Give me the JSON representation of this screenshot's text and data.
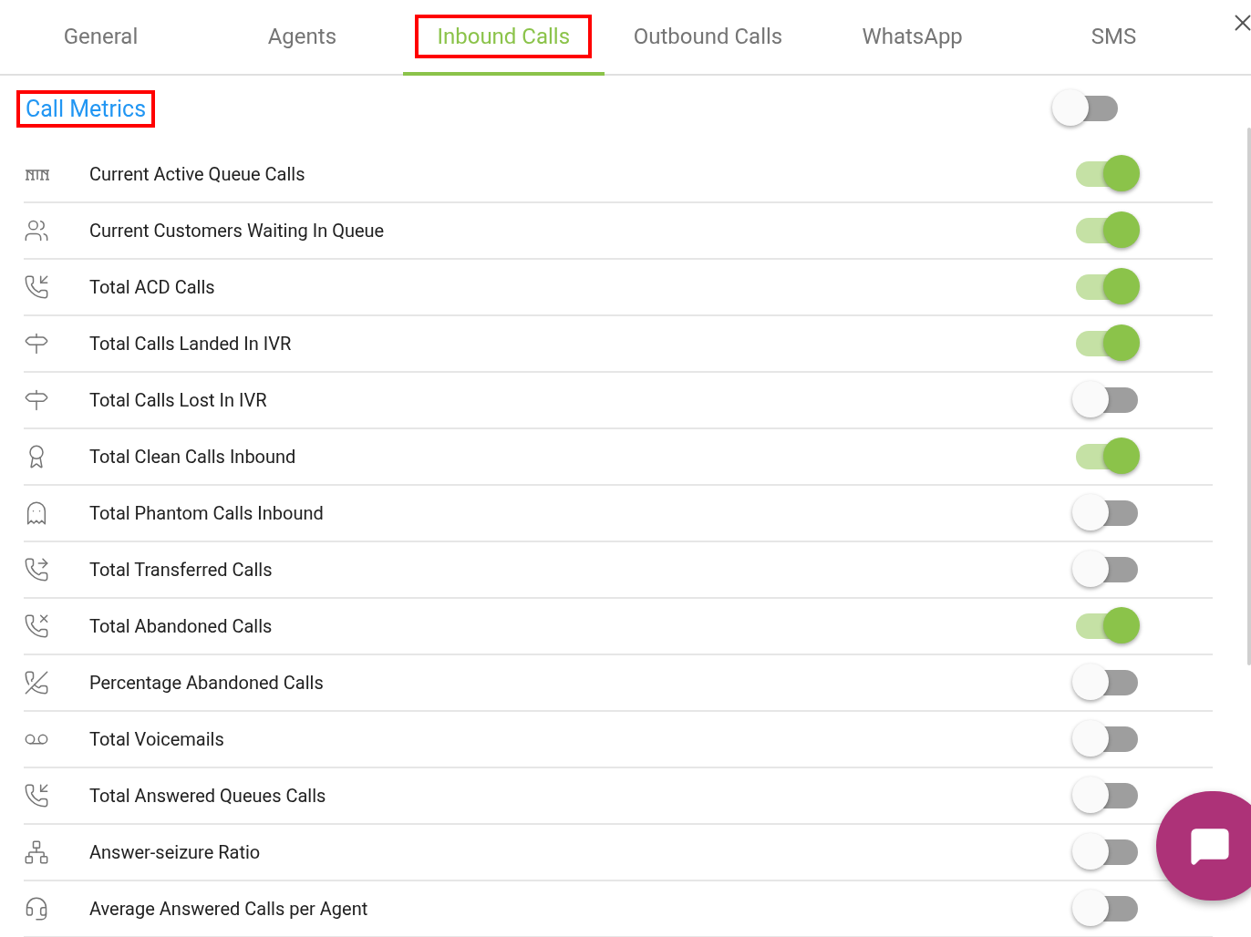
{
  "tabs": [
    {
      "label": "General",
      "selected": false,
      "highlighted": false
    },
    {
      "label": "Agents",
      "selected": false,
      "highlighted": false
    },
    {
      "label": "Inbound Calls",
      "selected": true,
      "highlighted": true
    },
    {
      "label": "Outbound Calls",
      "selected": false,
      "highlighted": false
    },
    {
      "label": "WhatsApp",
      "selected": false,
      "highlighted": false
    },
    {
      "label": "SMS",
      "selected": false,
      "highlighted": false
    }
  ],
  "section": {
    "title": "Call Metrics",
    "highlighted": true,
    "on": false
  },
  "metrics": [
    {
      "label": "Current Active Queue Calls",
      "on": true
    },
    {
      "label": "Current Customers Waiting In Queue",
      "on": true
    },
    {
      "label": "Total ACD Calls",
      "on": true
    },
    {
      "label": "Total Calls Landed In IVR",
      "on": true
    },
    {
      "label": "Total Calls Lost In IVR",
      "on": false
    },
    {
      "label": "Total Clean Calls Inbound",
      "on": true
    },
    {
      "label": "Total Phantom Calls Inbound",
      "on": false
    },
    {
      "label": "Total Transferred Calls",
      "on": false
    },
    {
      "label": "Total Abandoned Calls",
      "on": true
    },
    {
      "label": "Percentage Abandoned Calls",
      "on": false
    },
    {
      "label": "Total Voicemails",
      "on": false
    },
    {
      "label": "Total Answered Queues Calls",
      "on": false
    },
    {
      "label": "Answer-seizure Ratio",
      "on": false
    },
    {
      "label": "Average Answered Calls per Agent",
      "on": false
    }
  ]
}
